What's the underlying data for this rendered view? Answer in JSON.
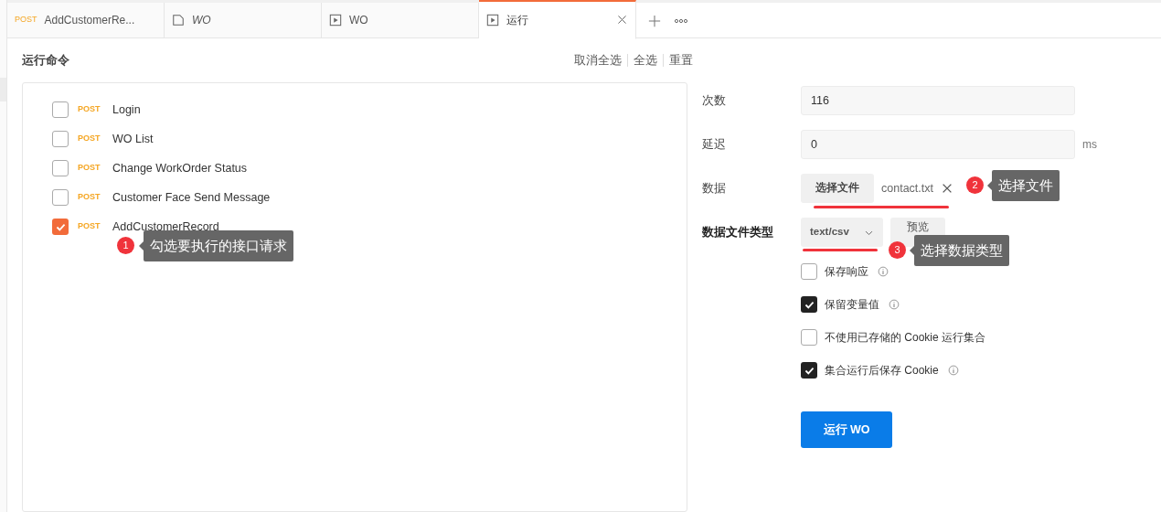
{
  "tabs": [
    {
      "kind": "request",
      "method": "POST",
      "label": "AddCustomerRe...",
      "italic": false,
      "selected": false
    },
    {
      "kind": "collection",
      "label": "WO",
      "italic": true,
      "selected": false
    },
    {
      "kind": "runner",
      "label": "WO",
      "italic": false,
      "selected": false
    },
    {
      "kind": "runner",
      "label": "运行",
      "italic": false,
      "selected": true,
      "closable": true
    }
  ],
  "runner": {
    "title": "运行命令",
    "actions": [
      "取消全选",
      "全选",
      "重置"
    ],
    "requests": [
      {
        "method": "POST",
        "name": "Login",
        "checked": false
      },
      {
        "method": "POST",
        "name": "WO List",
        "checked": false
      },
      {
        "method": "POST",
        "name": "Change WorkOrder Status",
        "checked": false
      },
      {
        "method": "POST",
        "name": "Customer Face Send Message",
        "checked": false
      },
      {
        "method": "POST",
        "name": "AddCustomerRecord",
        "checked": true
      }
    ]
  },
  "settings": {
    "iterations": {
      "label": "次数",
      "value": "116"
    },
    "delay": {
      "label": "延迟",
      "value": "0",
      "unit": "ms"
    },
    "data": {
      "label": "数据",
      "button": "选择文件",
      "file": "contact.txt"
    },
    "data_type": {
      "label": "数据文件类型",
      "value": "text/csv",
      "preview": "预览"
    },
    "options": [
      {
        "label": "保存响应",
        "checked": false,
        "info": true
      },
      {
        "label": "保留变量值",
        "checked": true,
        "info": true
      },
      {
        "label": "不使用已存储的 Cookie 运行集合",
        "checked": false,
        "info": false
      },
      {
        "label": "集合运行后保存 Cookie",
        "checked": true,
        "info": true
      }
    ],
    "run_button": "运行 WO"
  },
  "annotations": [
    {
      "number": "1",
      "text": "勾选要执行的接口请求"
    },
    {
      "number": "2",
      "text": "选择文件"
    },
    {
      "number": "3",
      "text": "选择数据类型"
    }
  ]
}
